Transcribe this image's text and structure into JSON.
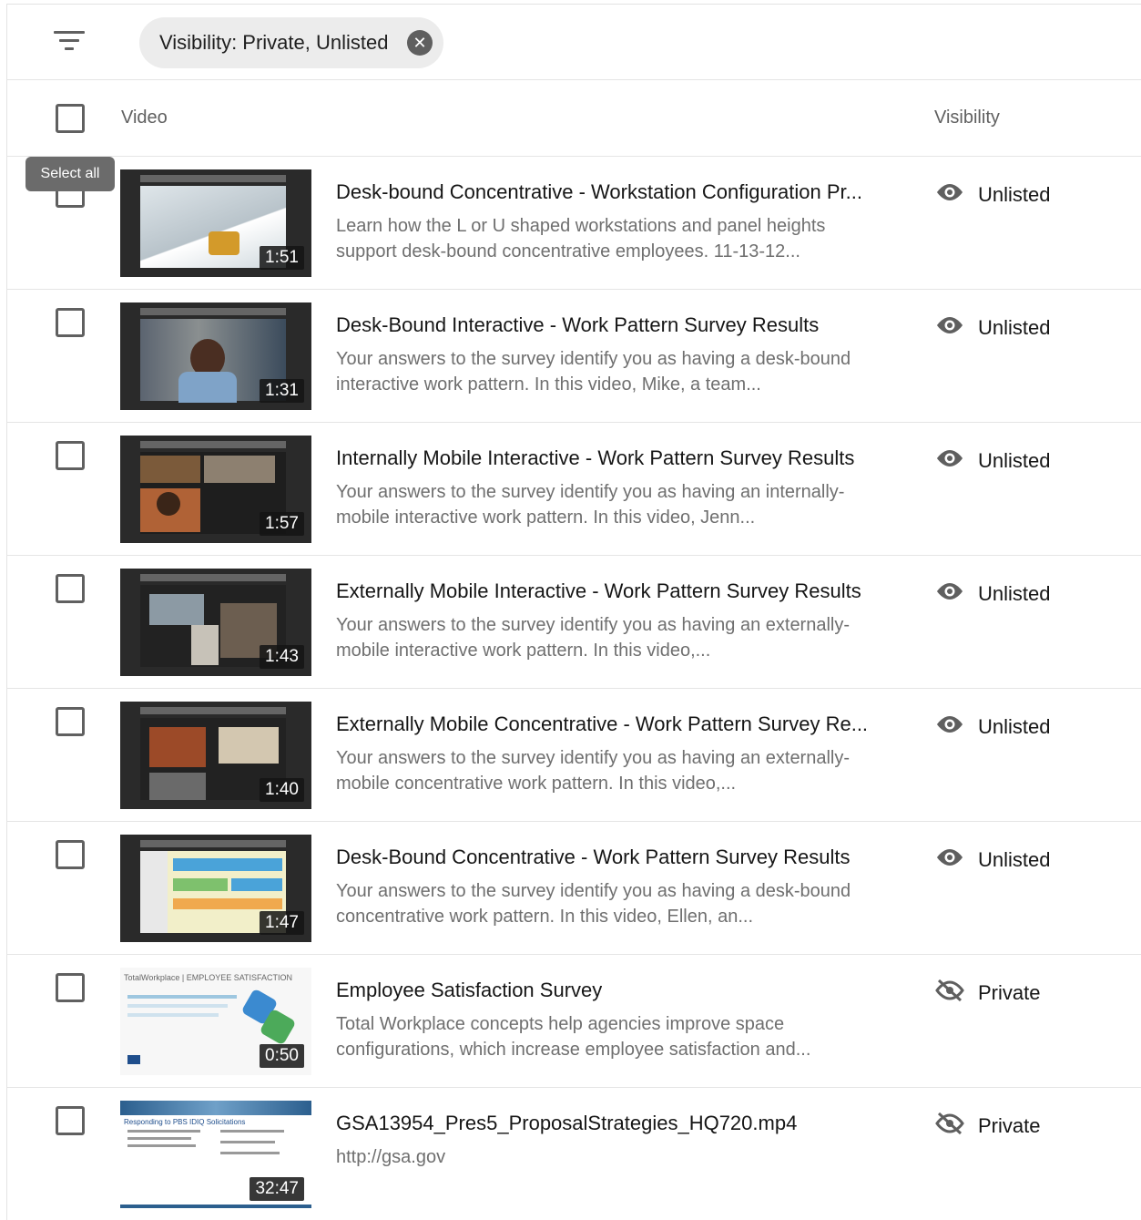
{
  "filter": {
    "chip_label": "Visibility: Private, Unlisted",
    "icon": "filter-icon",
    "close_icon": "close-icon"
  },
  "header": {
    "video": "Video",
    "visibility": "Visibility"
  },
  "tooltip": "Select all",
  "rows": [
    {
      "title": "Desk-bound Concentrative - Workstation Configuration Pr...",
      "description": "Learn how the L or U shaped workstations and panel heights support desk-bound concentrative employees. 11-13-12...",
      "duration": "1:51",
      "visibility": "Unlisted",
      "visibility_icon": "eye-icon"
    },
    {
      "title": "Desk-Bound Interactive - Work Pattern Survey Results",
      "description": "Your answers to the survey identify you as having a desk-bound interactive work pattern. In this video, Mike, a team...",
      "duration": "1:31",
      "visibility": "Unlisted",
      "visibility_icon": "eye-icon"
    },
    {
      "title": "Internally Mobile Interactive - Work Pattern Survey Results",
      "description": "Your answers to the survey identify you as having an internally-mobile interactive work pattern. In this video, Jenn...",
      "duration": "1:57",
      "visibility": "Unlisted",
      "visibility_icon": "eye-icon"
    },
    {
      "title": "Externally Mobile Interactive - Work Pattern Survey Results",
      "description": "Your answers to the survey identify you as having an externally-mobile interactive work pattern. In this video,...",
      "duration": "1:43",
      "visibility": "Unlisted",
      "visibility_icon": "eye-icon"
    },
    {
      "title": "Externally Mobile Concentrative - Work Pattern Survey Re...",
      "description": "Your answers to the survey identify you as having an externally-mobile concentrative work pattern. In this video,...",
      "duration": "1:40",
      "visibility": "Unlisted",
      "visibility_icon": "eye-icon"
    },
    {
      "title": "Desk-Bound Concentrative - Work Pattern Survey Results",
      "description": "Your answers to the survey identify you as having a desk-bound concentrative work pattern. In this video, Ellen, an...",
      "duration": "1:47",
      "visibility": "Unlisted",
      "visibility_icon": "eye-icon"
    },
    {
      "title": "Employee Satisfaction Survey",
      "description": "Total Workplace concepts help agencies improve space configurations, which increase employee satisfaction and...",
      "duration": "0:50",
      "visibility": "Private",
      "visibility_icon": "eye-off-icon",
      "thumb_text": "TotalWorkplace | EMPLOYEE SATISFACTION"
    },
    {
      "title": "GSA13954_Pres5_ProposalStrategies_HQ720.mp4",
      "description": "http://gsa.gov",
      "duration": "32:47",
      "visibility": "Private",
      "visibility_icon": "eye-off-icon",
      "thumb_text": "Responding to PBS IDIQ Solicitations"
    }
  ]
}
